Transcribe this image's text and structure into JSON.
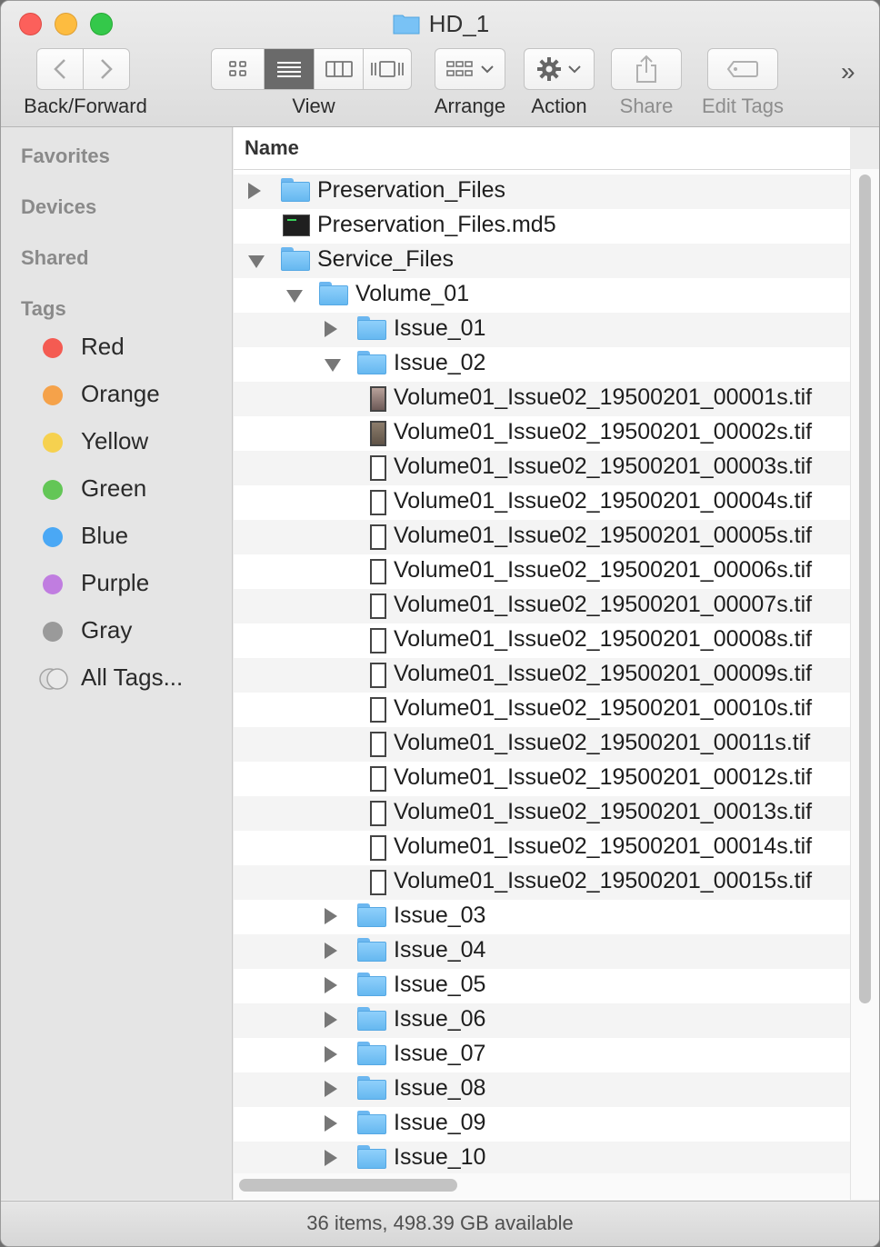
{
  "window": {
    "title": "HD_1",
    "status": "36 items, 498.39 GB available"
  },
  "toolbar": {
    "back_forward_label": "Back/Forward",
    "view_label": "View",
    "arrange_label": "Arrange",
    "action_label": "Action",
    "share_label": "Share",
    "edit_tags_label": "Edit Tags",
    "overflow": "»",
    "active_view": "list"
  },
  "sidebar": {
    "sections": {
      "favorites": "Favorites",
      "devices": "Devices",
      "shared": "Shared",
      "tags": "Tags"
    },
    "tags": [
      {
        "label": "Red",
        "color": "#f45b52"
      },
      {
        "label": "Orange",
        "color": "#f5a24a"
      },
      {
        "label": "Yellow",
        "color": "#f6d14f"
      },
      {
        "label": "Green",
        "color": "#63c656"
      },
      {
        "label": "Blue",
        "color": "#4aa8f5"
      },
      {
        "label": "Purple",
        "color": "#c07de0"
      },
      {
        "label": "Gray",
        "color": "#9a9a9a"
      },
      {
        "label": "All Tags...",
        "color": ""
      }
    ]
  },
  "list": {
    "column_header": "Name",
    "rows": [
      {
        "name": "Preservation_Files",
        "type": "folder",
        "depth": 0,
        "disclosure": "closed"
      },
      {
        "name": "Preservation_Files.md5",
        "type": "terminal-file",
        "depth": 0,
        "disclosure": "none"
      },
      {
        "name": "Service_Files",
        "type": "folder",
        "depth": 0,
        "disclosure": "open"
      },
      {
        "name": "Volume_01",
        "type": "folder",
        "depth": 1,
        "disclosure": "open"
      },
      {
        "name": "Issue_01",
        "type": "folder",
        "depth": 2,
        "disclosure": "closed"
      },
      {
        "name": "Issue_02",
        "type": "folder",
        "depth": 2,
        "disclosure": "open"
      },
      {
        "name": "Volume01_Issue02_19500201_00001s.tif",
        "type": "tif-photo",
        "depth": 3,
        "disclosure": "none"
      },
      {
        "name": "Volume01_Issue02_19500201_00002s.tif",
        "type": "tif-dark",
        "depth": 3,
        "disclosure": "none"
      },
      {
        "name": "Volume01_Issue02_19500201_00003s.tif",
        "type": "tif",
        "depth": 3,
        "disclosure": "none"
      },
      {
        "name": "Volume01_Issue02_19500201_00004s.tif",
        "type": "tif",
        "depth": 3,
        "disclosure": "none"
      },
      {
        "name": "Volume01_Issue02_19500201_00005s.tif",
        "type": "tif",
        "depth": 3,
        "disclosure": "none"
      },
      {
        "name": "Volume01_Issue02_19500201_00006s.tif",
        "type": "tif",
        "depth": 3,
        "disclosure": "none"
      },
      {
        "name": "Volume01_Issue02_19500201_00007s.tif",
        "type": "tif",
        "depth": 3,
        "disclosure": "none"
      },
      {
        "name": "Volume01_Issue02_19500201_00008s.tif",
        "type": "tif",
        "depth": 3,
        "disclosure": "none"
      },
      {
        "name": "Volume01_Issue02_19500201_00009s.tif",
        "type": "tif",
        "depth": 3,
        "disclosure": "none"
      },
      {
        "name": "Volume01_Issue02_19500201_00010s.tif",
        "type": "tif",
        "depth": 3,
        "disclosure": "none"
      },
      {
        "name": "Volume01_Issue02_19500201_00011s.tif",
        "type": "tif",
        "depth": 3,
        "disclosure": "none"
      },
      {
        "name": "Volume01_Issue02_19500201_00012s.tif",
        "type": "tif",
        "depth": 3,
        "disclosure": "none"
      },
      {
        "name": "Volume01_Issue02_19500201_00013s.tif",
        "type": "tif",
        "depth": 3,
        "disclosure": "none"
      },
      {
        "name": "Volume01_Issue02_19500201_00014s.tif",
        "type": "tif",
        "depth": 3,
        "disclosure": "none"
      },
      {
        "name": "Volume01_Issue02_19500201_00015s.tif",
        "type": "tif",
        "depth": 3,
        "disclosure": "none"
      },
      {
        "name": "Issue_03",
        "type": "folder",
        "depth": 2,
        "disclosure": "closed"
      },
      {
        "name": "Issue_04",
        "type": "folder",
        "depth": 2,
        "disclosure": "closed"
      },
      {
        "name": "Issue_05",
        "type": "folder",
        "depth": 2,
        "disclosure": "closed"
      },
      {
        "name": "Issue_06",
        "type": "folder",
        "depth": 2,
        "disclosure": "closed"
      },
      {
        "name": "Issue_07",
        "type": "folder",
        "depth": 2,
        "disclosure": "closed"
      },
      {
        "name": "Issue_08",
        "type": "folder",
        "depth": 2,
        "disclosure": "closed"
      },
      {
        "name": "Issue_09",
        "type": "folder",
        "depth": 2,
        "disclosure": "closed"
      },
      {
        "name": "Issue_10",
        "type": "folder",
        "depth": 2,
        "disclosure": "closed"
      }
    ]
  }
}
